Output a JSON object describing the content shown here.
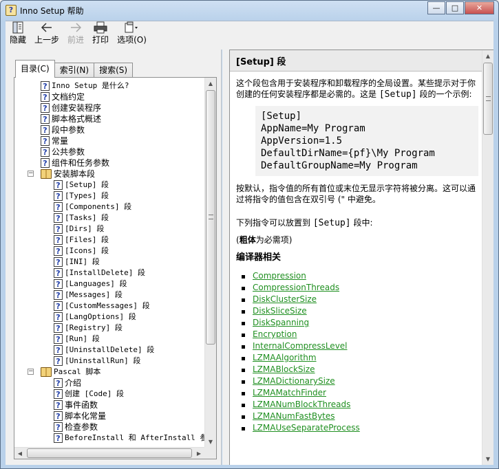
{
  "window": {
    "title": "Inno Setup 帮助",
    "minimize": "—",
    "maximize": "□",
    "close": "✕"
  },
  "toolbar": {
    "hide": {
      "label": "隐藏",
      "icon": "hide-icon"
    },
    "back": {
      "label": "上一步",
      "icon": "back-arrow-icon"
    },
    "forward": {
      "label": "前进",
      "icon": "forward-arrow-icon"
    },
    "print": {
      "label": "打印",
      "icon": "printer-icon"
    },
    "options": {
      "label": "选项(O)",
      "icon": "options-icon"
    }
  },
  "tabs": [
    {
      "label": "目录(C)",
      "active": true
    },
    {
      "label": "索引(N)",
      "active": false
    },
    {
      "label": "搜索(S)",
      "active": false
    }
  ],
  "tree": [
    {
      "label": "Inno Setup 是什么?",
      "indent": 0,
      "kind": "page",
      "mono": true
    },
    {
      "label": "文档约定",
      "indent": 0,
      "kind": "page"
    },
    {
      "label": "创建安装程序",
      "indent": 0,
      "kind": "page"
    },
    {
      "label": "脚本格式概述",
      "indent": 0,
      "kind": "page"
    },
    {
      "label": "段中参数",
      "indent": 0,
      "kind": "page"
    },
    {
      "label": "常量",
      "indent": 0,
      "kind": "page"
    },
    {
      "label": "公共参数",
      "indent": 0,
      "kind": "page"
    },
    {
      "label": "组件和任务参数",
      "indent": 0,
      "kind": "page"
    },
    {
      "label": "安装脚本段",
      "indent": 0,
      "kind": "book",
      "expander": "−"
    },
    {
      "label": "[Setup] 段",
      "indent": 1,
      "kind": "page",
      "mono": true
    },
    {
      "label": "[Types] 段",
      "indent": 1,
      "kind": "page",
      "mono": true
    },
    {
      "label": "[Components] 段",
      "indent": 1,
      "kind": "page",
      "mono": true
    },
    {
      "label": "[Tasks] 段",
      "indent": 1,
      "kind": "page",
      "mono": true
    },
    {
      "label": "[Dirs] 段",
      "indent": 1,
      "kind": "page",
      "mono": true
    },
    {
      "label": "[Files] 段",
      "indent": 1,
      "kind": "page",
      "mono": true
    },
    {
      "label": "[Icons] 段",
      "indent": 1,
      "kind": "page",
      "mono": true
    },
    {
      "label": "[INI] 段",
      "indent": 1,
      "kind": "page",
      "mono": true
    },
    {
      "label": "[InstallDelete] 段",
      "indent": 1,
      "kind": "page",
      "mono": true
    },
    {
      "label": "[Languages] 段",
      "indent": 1,
      "kind": "page",
      "mono": true
    },
    {
      "label": "[Messages] 段",
      "indent": 1,
      "kind": "page",
      "mono": true
    },
    {
      "label": "[CustomMessages] 段",
      "indent": 1,
      "kind": "page",
      "mono": true
    },
    {
      "label": "[LangOptions] 段",
      "indent": 1,
      "kind": "page",
      "mono": true
    },
    {
      "label": "[Registry] 段",
      "indent": 1,
      "kind": "page",
      "mono": true
    },
    {
      "label": "[Run] 段",
      "indent": 1,
      "kind": "page",
      "mono": true
    },
    {
      "label": "[UninstallDelete] 段",
      "indent": 1,
      "kind": "page",
      "mono": true
    },
    {
      "label": "[UninstallRun] 段",
      "indent": 1,
      "kind": "page",
      "mono": true
    },
    {
      "label": "Pascal 脚本",
      "indent": 0,
      "kind": "book",
      "expander": "−",
      "mono": true
    },
    {
      "label": "介绍",
      "indent": 1,
      "kind": "page"
    },
    {
      "label": "创建 [Code] 段",
      "indent": 1,
      "kind": "page",
      "mono": true
    },
    {
      "label": "事件函数",
      "indent": 1,
      "kind": "page"
    },
    {
      "label": "脚本化常量",
      "indent": 1,
      "kind": "page"
    },
    {
      "label": "检查参数",
      "indent": 1,
      "kind": "page"
    },
    {
      "label": "BeforeInstall 和 AfterInstall 参数",
      "indent": 1,
      "kind": "page",
      "mono": true
    }
  ],
  "content": {
    "title": "[Setup] 段",
    "intro_a": "这个段包含用于安装程序和卸载程序的全局设置。某些提示对于你创建的任何安装程序都是必需的。这是 ",
    "intro_code": "[Setup]",
    "intro_b": " 段的一个示例:",
    "code": "[Setup]\nAppName=My Program\nAppVersion=1.5\nDefaultDirName={pf}\\My Program\nDefaultGroupName=My Program",
    "note": "按默认，指令值的所有首位或末位无显示字符将被分离。这可以通过将指令的值包含在双引号 (\" 中避免。",
    "list_intro_a": "下列指令可以放置到 ",
    "list_intro_code": "[Setup]",
    "list_intro_b": " 段中:",
    "bold_note_a": "(",
    "bold_note_b": "粗体",
    "bold_note_c": "为必需项)",
    "section_heading": "编译器相关",
    "directives": [
      "Compression",
      "CompressionThreads",
      "DiskClusterSize",
      "DiskSliceSize",
      "DiskSpanning",
      "Encryption",
      "InternalCompressLevel",
      "LZMAAlgorithm",
      "LZMABlockSize",
      "LZMADictionarySize",
      "LZMAMatchFinder",
      "LZMANumBlockThreads",
      "LZMANumFastBytes",
      "LZMAUseSeparateProcess"
    ]
  },
  "colors": {
    "link": "#1f8f20",
    "title_bar": "#b9d1ea",
    "header_band": "#eaeaea"
  }
}
